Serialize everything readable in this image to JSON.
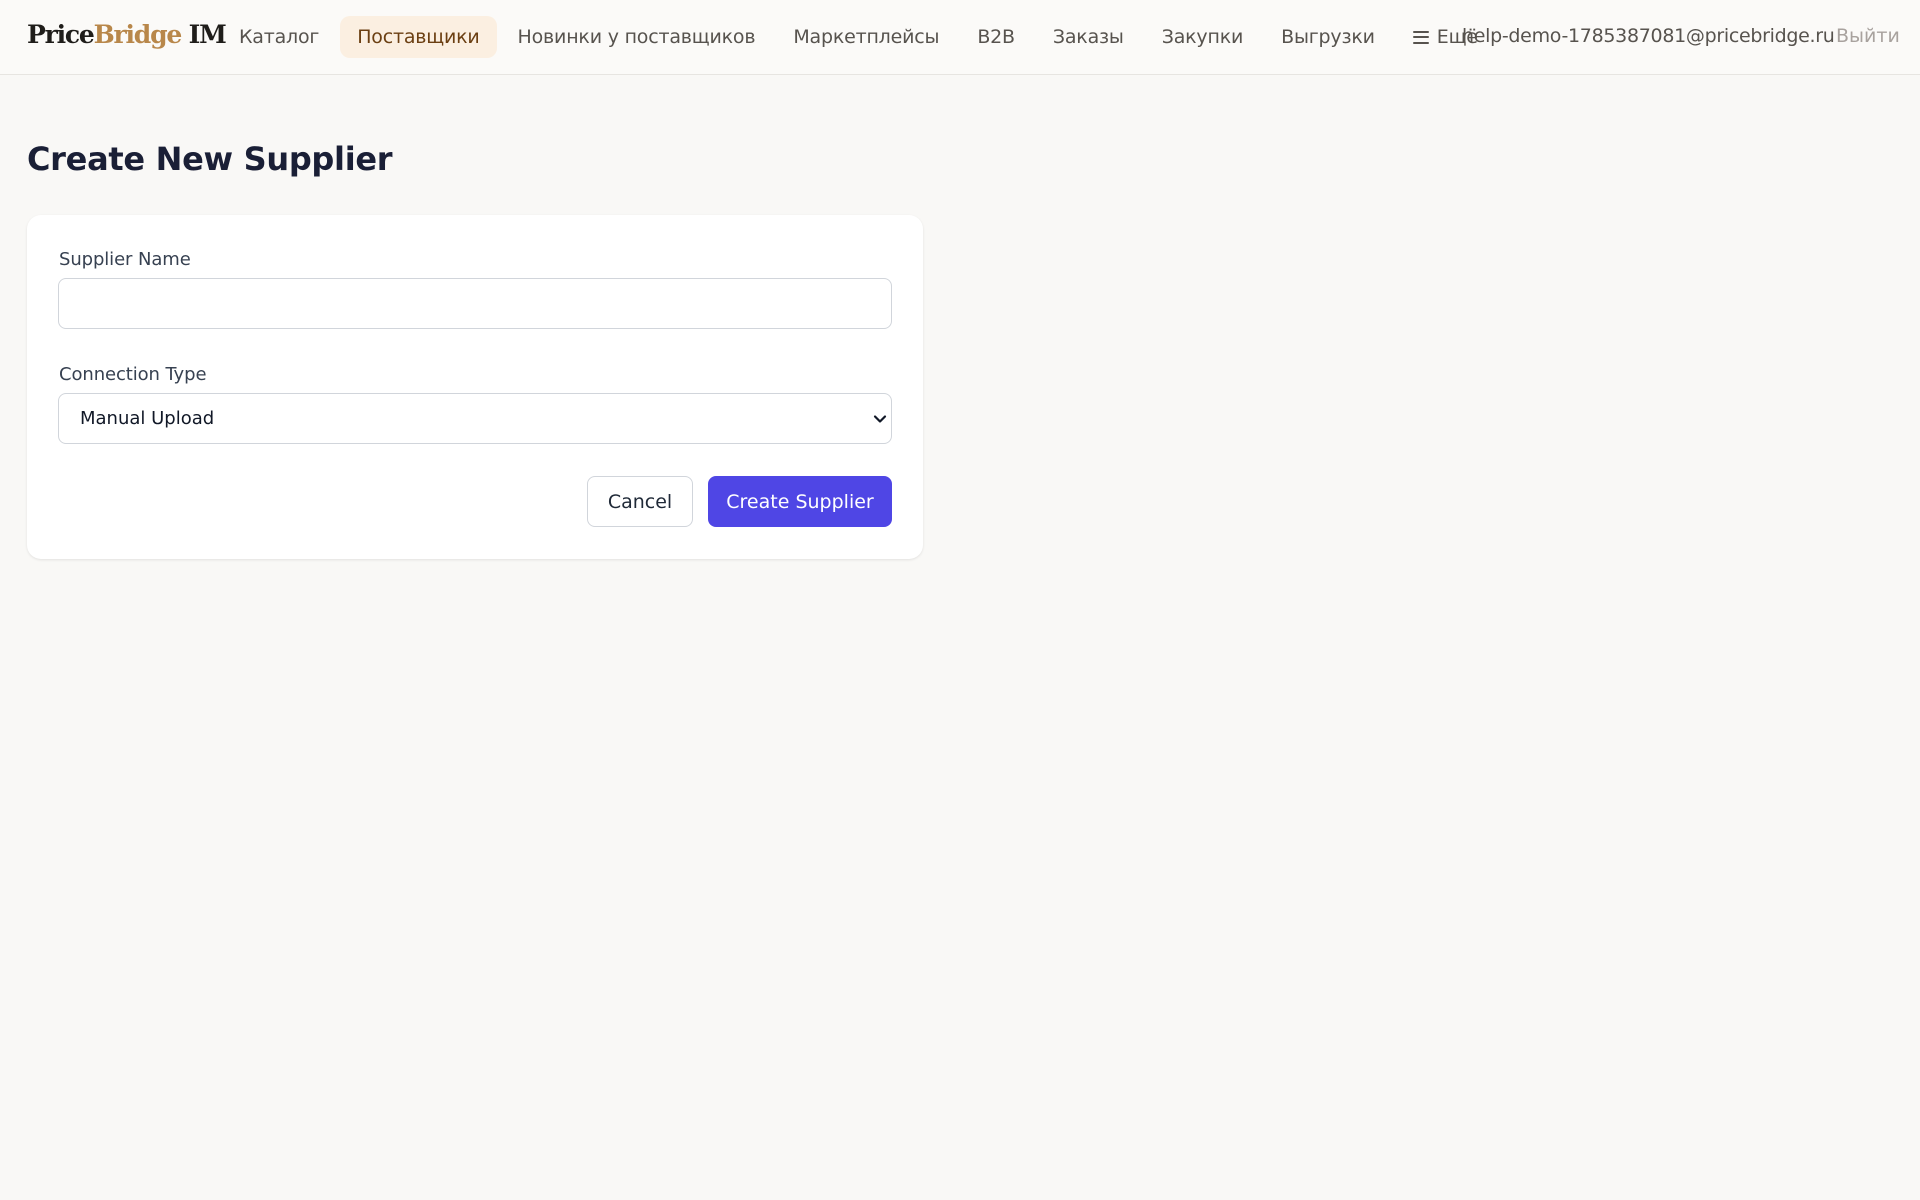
{
  "header": {
    "logo": {
      "part1": "Price",
      "part2": "Bridge",
      "part3": " IM"
    },
    "nav": [
      {
        "label": "Каталог",
        "active": false
      },
      {
        "label": "Поставщики",
        "active": true
      },
      {
        "label": "Новинки у поставщиков",
        "active": false
      },
      {
        "label": "Маркетплейсы",
        "active": false
      },
      {
        "label": "B2B",
        "active": false
      },
      {
        "label": "Заказы",
        "active": false
      },
      {
        "label": "Закупки",
        "active": false
      },
      {
        "label": "Выгрузки",
        "active": false
      }
    ],
    "more": {
      "label": "Ещё",
      "icon": "menu-icon"
    },
    "user_email": "help-demo-1785387081@pricebridge.ru",
    "logout_label": "Выйти"
  },
  "page": {
    "title": "Create New Supplier"
  },
  "form": {
    "supplier_name": {
      "label": "Supplier Name",
      "value": "",
      "placeholder": ""
    },
    "connection_type": {
      "label": "Connection Type",
      "selected": "Manual Upload"
    },
    "cancel_label": "Cancel",
    "submit_label": "Create Supplier"
  },
  "colors": {
    "primary": "#4f46e5",
    "logo_accent": "#b8874a",
    "active_nav_bg": "#fbefe1",
    "active_nav_text": "#6b3f12",
    "page_bg": "#f9f8f6"
  }
}
